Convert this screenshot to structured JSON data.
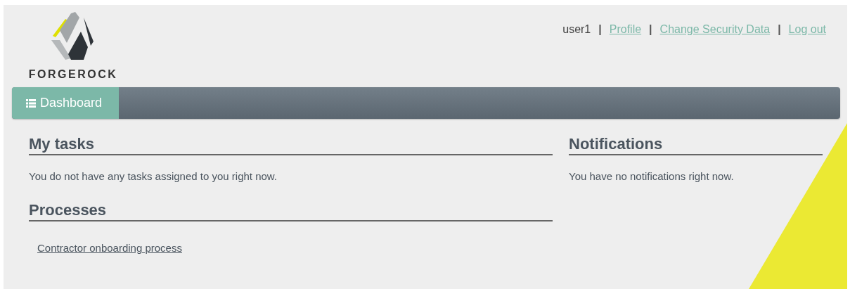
{
  "brand": {
    "name": "FORGEROCK"
  },
  "user_menu": {
    "username": "user1",
    "separator": "|",
    "links": [
      "Profile",
      "Change Security Data",
      "Log out"
    ]
  },
  "navbar": {
    "tabs": [
      {
        "label": "Dashboard",
        "selected": true
      }
    ]
  },
  "sections": [
    {
      "kind": "tasks",
      "title": "My tasks",
      "message": "You do not have any tasks assigned to you right now."
    },
    {
      "kind": "processes",
      "title": "Processes",
      "links": [
        "Contractor onboarding process"
      ]
    },
    {
      "kind": "notifications",
      "title": "Notifications",
      "message": "You have no notifications right now."
    }
  ]
}
